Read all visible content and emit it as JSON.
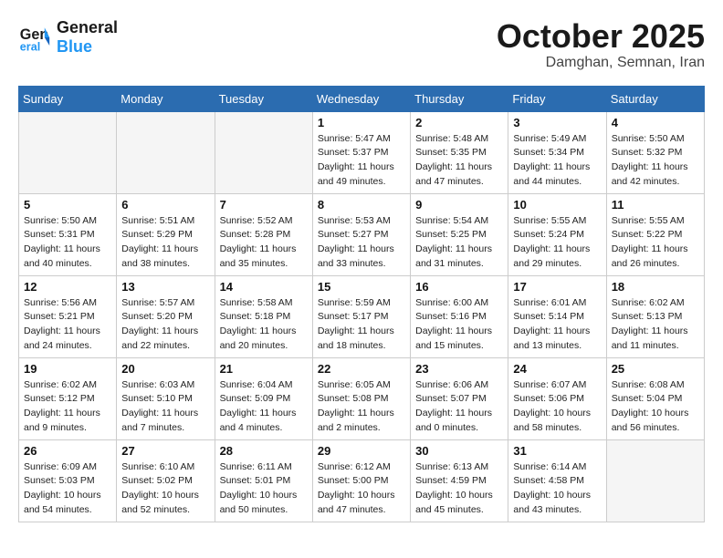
{
  "header": {
    "logo_line1": "General",
    "logo_line2": "Blue",
    "month": "October 2025",
    "location": "Damghan, Semnan, Iran"
  },
  "weekdays": [
    "Sunday",
    "Monday",
    "Tuesday",
    "Wednesday",
    "Thursday",
    "Friday",
    "Saturday"
  ],
  "weeks": [
    [
      {
        "day": "",
        "empty": true
      },
      {
        "day": "",
        "empty": true
      },
      {
        "day": "",
        "empty": true
      },
      {
        "day": "1",
        "info": "Sunrise: 5:47 AM\nSunset: 5:37 PM\nDaylight: 11 hours\nand 49 minutes."
      },
      {
        "day": "2",
        "info": "Sunrise: 5:48 AM\nSunset: 5:35 PM\nDaylight: 11 hours\nand 47 minutes."
      },
      {
        "day": "3",
        "info": "Sunrise: 5:49 AM\nSunset: 5:34 PM\nDaylight: 11 hours\nand 44 minutes."
      },
      {
        "day": "4",
        "info": "Sunrise: 5:50 AM\nSunset: 5:32 PM\nDaylight: 11 hours\nand 42 minutes."
      }
    ],
    [
      {
        "day": "5",
        "info": "Sunrise: 5:50 AM\nSunset: 5:31 PM\nDaylight: 11 hours\nand 40 minutes."
      },
      {
        "day": "6",
        "info": "Sunrise: 5:51 AM\nSunset: 5:29 PM\nDaylight: 11 hours\nand 38 minutes."
      },
      {
        "day": "7",
        "info": "Sunrise: 5:52 AM\nSunset: 5:28 PM\nDaylight: 11 hours\nand 35 minutes."
      },
      {
        "day": "8",
        "info": "Sunrise: 5:53 AM\nSunset: 5:27 PM\nDaylight: 11 hours\nand 33 minutes."
      },
      {
        "day": "9",
        "info": "Sunrise: 5:54 AM\nSunset: 5:25 PM\nDaylight: 11 hours\nand 31 minutes."
      },
      {
        "day": "10",
        "info": "Sunrise: 5:55 AM\nSunset: 5:24 PM\nDaylight: 11 hours\nand 29 minutes."
      },
      {
        "day": "11",
        "info": "Sunrise: 5:55 AM\nSunset: 5:22 PM\nDaylight: 11 hours\nand 26 minutes."
      }
    ],
    [
      {
        "day": "12",
        "info": "Sunrise: 5:56 AM\nSunset: 5:21 PM\nDaylight: 11 hours\nand 24 minutes."
      },
      {
        "day": "13",
        "info": "Sunrise: 5:57 AM\nSunset: 5:20 PM\nDaylight: 11 hours\nand 22 minutes."
      },
      {
        "day": "14",
        "info": "Sunrise: 5:58 AM\nSunset: 5:18 PM\nDaylight: 11 hours\nand 20 minutes."
      },
      {
        "day": "15",
        "info": "Sunrise: 5:59 AM\nSunset: 5:17 PM\nDaylight: 11 hours\nand 18 minutes."
      },
      {
        "day": "16",
        "info": "Sunrise: 6:00 AM\nSunset: 5:16 PM\nDaylight: 11 hours\nand 15 minutes."
      },
      {
        "day": "17",
        "info": "Sunrise: 6:01 AM\nSunset: 5:14 PM\nDaylight: 11 hours\nand 13 minutes."
      },
      {
        "day": "18",
        "info": "Sunrise: 6:02 AM\nSunset: 5:13 PM\nDaylight: 11 hours\nand 11 minutes."
      }
    ],
    [
      {
        "day": "19",
        "info": "Sunrise: 6:02 AM\nSunset: 5:12 PM\nDaylight: 11 hours\nand 9 minutes."
      },
      {
        "day": "20",
        "info": "Sunrise: 6:03 AM\nSunset: 5:10 PM\nDaylight: 11 hours\nand 7 minutes."
      },
      {
        "day": "21",
        "info": "Sunrise: 6:04 AM\nSunset: 5:09 PM\nDaylight: 11 hours\nand 4 minutes."
      },
      {
        "day": "22",
        "info": "Sunrise: 6:05 AM\nSunset: 5:08 PM\nDaylight: 11 hours\nand 2 minutes."
      },
      {
        "day": "23",
        "info": "Sunrise: 6:06 AM\nSunset: 5:07 PM\nDaylight: 11 hours\nand 0 minutes."
      },
      {
        "day": "24",
        "info": "Sunrise: 6:07 AM\nSunset: 5:06 PM\nDaylight: 10 hours\nand 58 minutes."
      },
      {
        "day": "25",
        "info": "Sunrise: 6:08 AM\nSunset: 5:04 PM\nDaylight: 10 hours\nand 56 minutes."
      }
    ],
    [
      {
        "day": "26",
        "info": "Sunrise: 6:09 AM\nSunset: 5:03 PM\nDaylight: 10 hours\nand 54 minutes."
      },
      {
        "day": "27",
        "info": "Sunrise: 6:10 AM\nSunset: 5:02 PM\nDaylight: 10 hours\nand 52 minutes."
      },
      {
        "day": "28",
        "info": "Sunrise: 6:11 AM\nSunset: 5:01 PM\nDaylight: 10 hours\nand 50 minutes."
      },
      {
        "day": "29",
        "info": "Sunrise: 6:12 AM\nSunset: 5:00 PM\nDaylight: 10 hours\nand 47 minutes."
      },
      {
        "day": "30",
        "info": "Sunrise: 6:13 AM\nSunset: 4:59 PM\nDaylight: 10 hours\nand 45 minutes."
      },
      {
        "day": "31",
        "info": "Sunrise: 6:14 AM\nSunset: 4:58 PM\nDaylight: 10 hours\nand 43 minutes."
      },
      {
        "day": "",
        "empty": true
      }
    ]
  ]
}
